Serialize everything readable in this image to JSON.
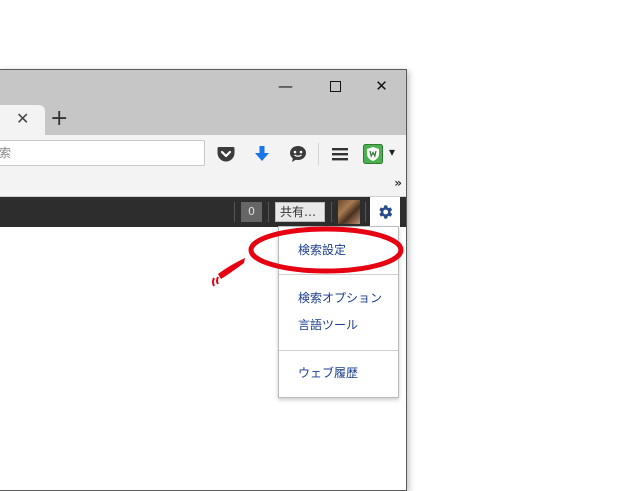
{
  "window": {
    "minimize_icon": "minimize-icon",
    "maximize_icon": "maximize-icon",
    "close_icon": "close-icon",
    "minimize_glyph": "—",
    "maximize_glyph": "☐",
    "close_glyph": "✕"
  },
  "tabstrip": {
    "tab_close_glyph": "✕",
    "new_tab_glyph": "+"
  },
  "toolbar": {
    "url_text": "索",
    "pocket_icon": "pocket-icon",
    "download_icon": "download-arrow-icon",
    "chat_icon": "speech-bubble-icon",
    "menu_icon": "hamburger-menu-icon",
    "extension_icon": "green-shield-extension-icon",
    "extension_dropdown_glyph": "▾"
  },
  "bookmarks": {
    "overflow_glyph": "»"
  },
  "google_bar": {
    "notification_count": "0",
    "share_label": "共有…",
    "settings_icon": "gear-icon"
  },
  "settings_menu": {
    "items": [
      {
        "label": "検索設定"
      },
      {
        "label": "検索オプション"
      },
      {
        "label": "言語ツール"
      },
      {
        "label": "ウェブ履歴"
      }
    ]
  },
  "annotation": {
    "highlight_color": "#e60012"
  }
}
